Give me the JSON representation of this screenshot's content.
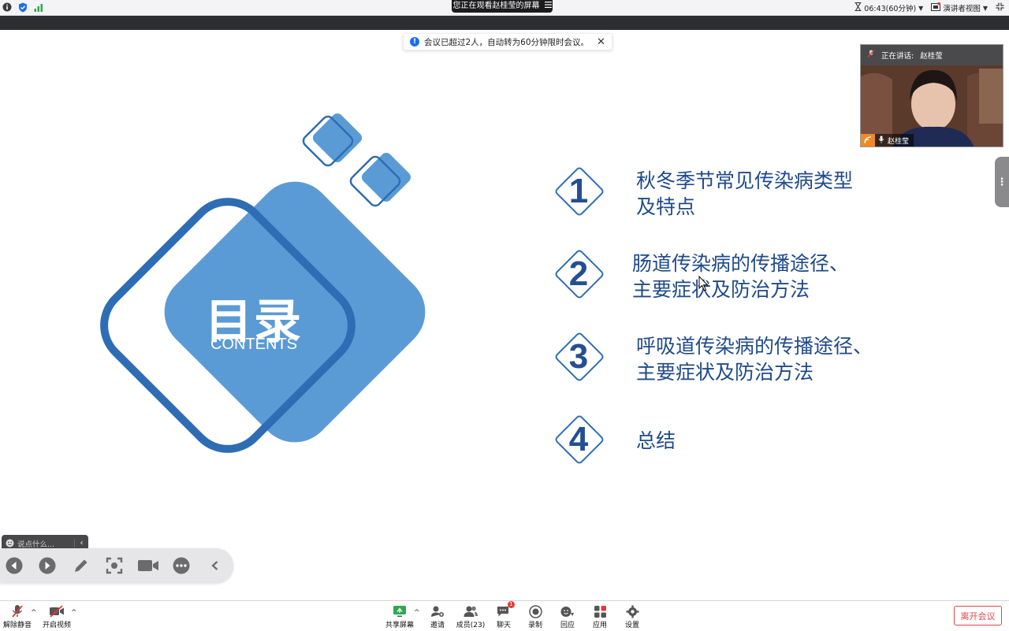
{
  "topbar": {
    "share_banner": "您正在观看赵桂莹的屏幕",
    "timer": "06:43(60分钟)",
    "view_mode": "演讲者视图"
  },
  "notice": {
    "text": "会议已超过2人，自动转为60分钟限时会议。"
  },
  "slide": {
    "title": "目录",
    "subtitle": "CONTENTS",
    "items": [
      {
        "num": "1",
        "line1": "秋冬季节常见传染病类型",
        "line2": "及特点"
      },
      {
        "num": "2",
        "line1": "肠道传染病的传播途径、",
        "line2": "主要症状及防治方法"
      },
      {
        "num": "3",
        "line1": "呼吸道传染病的传播途径、",
        "line2": "主要症状及防治方法"
      },
      {
        "num": "4",
        "line1": "总结",
        "line2": ""
      }
    ],
    "colors": {
      "main_blue": "#5b9bd5",
      "dark_blue": "#2e6db4",
      "text_blue": "#1f4a8a"
    }
  },
  "speaker": {
    "label": "正在讲话:",
    "name": "赵桂莹",
    "tile_name": "赵桂莹"
  },
  "comment": {
    "placeholder": "说点什么..."
  },
  "toolbar": {
    "unmute": "解除静音",
    "start_video": "开启视频",
    "share_screen": "共享屏幕",
    "invite": "邀请",
    "participants": "成员(23)",
    "chat": "聊天",
    "record": "录制",
    "reactions": "回应",
    "apps": "应用",
    "settings": "设置",
    "chat_badge": "1",
    "leave": "离开会议"
  }
}
